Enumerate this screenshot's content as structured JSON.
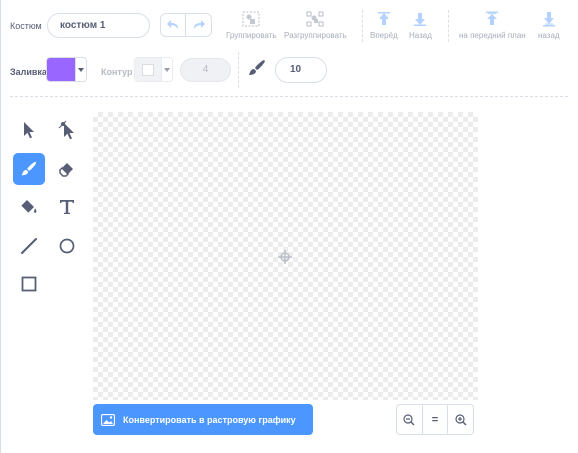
{
  "costume": {
    "label": "Костюм",
    "name_value": "костюм 1"
  },
  "toolbar": {
    "group_label": "Группировать",
    "ungroup_label": "Разгруппировать",
    "forward_label": "Вперёд",
    "backward_label": "Назад",
    "front_label": "на передний план",
    "back_label": "назад"
  },
  "fill": {
    "label": "Заливка",
    "color": "#9966ff"
  },
  "outline": {
    "label": "Контур",
    "width_value": "4"
  },
  "brush": {
    "size_value": "10"
  },
  "tools": [
    "select-tool",
    "reshape-tool",
    "brush-tool",
    "eraser-tool",
    "fill-tool",
    "text-tool",
    "line-tool",
    "circle-tool",
    "rectangle-tool"
  ],
  "active_tool": "brush-tool",
  "actions": {
    "convert_bitmap_label": "Конвертировать в растровую графику"
  },
  "zoom": {
    "reset_label": "="
  },
  "colors": {
    "accent": "#4c97ff",
    "text": "#575e75",
    "disabled": "#a7adb8"
  }
}
